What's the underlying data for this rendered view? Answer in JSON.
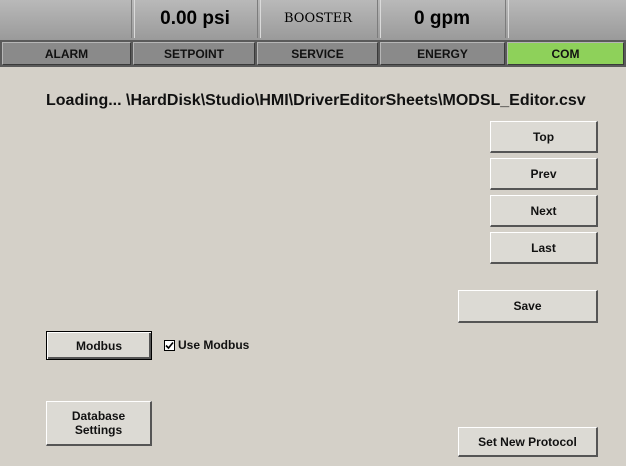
{
  "header": {
    "pressure": "0.00 psi",
    "mode": "BOOSTER",
    "flow": "0 gpm"
  },
  "tabs": [
    {
      "label": "ALARM",
      "active": false
    },
    {
      "label": "SETPOINT",
      "active": false
    },
    {
      "label": "SERVICE",
      "active": false
    },
    {
      "label": "ENERGY",
      "active": false
    },
    {
      "label": "COM",
      "active": true
    }
  ],
  "status": {
    "loading_text": "Loading... \\HardDisk\\Studio\\HMI\\DriverEditorSheets\\MODSL_Editor.csv"
  },
  "nav_buttons": {
    "top": "Top",
    "prev": "Prev",
    "next": "Next",
    "last": "Last"
  },
  "actions": {
    "save": "Save",
    "modbus": "Modbus",
    "use_modbus_label": "Use Modbus",
    "use_modbus_checked": true,
    "database_settings_line1": "Database",
    "database_settings_line2": "Settings",
    "set_new_protocol": "Set New Protocol"
  },
  "colors": {
    "active_tab": "#8ed15a",
    "background": "#d4d0c8"
  }
}
